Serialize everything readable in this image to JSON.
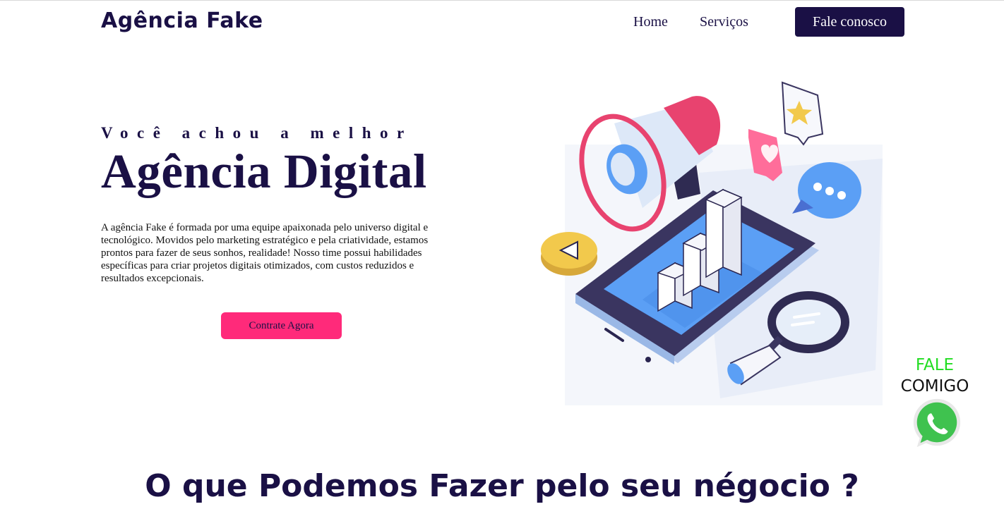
{
  "header": {
    "logo": "Agência Fake",
    "nav": {
      "home": "Home",
      "services": "Serviços"
    },
    "cta": "Fale conosco"
  },
  "hero": {
    "kicker": "Você achou a melhor",
    "title": "Agência Digital",
    "description": "A agência Fake é formada por uma equipe apaixonada pelo universo digital e tecnológico. Movidos pelo marketing estratégico e pela criatividade, estamos prontos para fazer de seus sonhos, realidade! Nosso time possui habilidades específicas para criar projetos digitais otimizados, com custos reduzidos e resultados excepcionais.",
    "cta": "Contrate Agora",
    "illustration_icons": [
      "megaphone-icon",
      "smartphone-icon",
      "bar-chart-icon",
      "magnifier-icon",
      "heart-bubble-icon",
      "star-bubble-icon",
      "chat-bubble-icon",
      "play-coin-icon"
    ]
  },
  "whatsapp": {
    "line1": "FALE",
    "line2": "COMIGO",
    "icon": "whatsapp-icon"
  },
  "services": {
    "title": "O que Podemos Fazer pelo seu négocio ?"
  },
  "colors": {
    "brand_dark": "#1a1045",
    "accent_pink": "#ff2a7a",
    "whatsapp_green": "#22dd22"
  }
}
